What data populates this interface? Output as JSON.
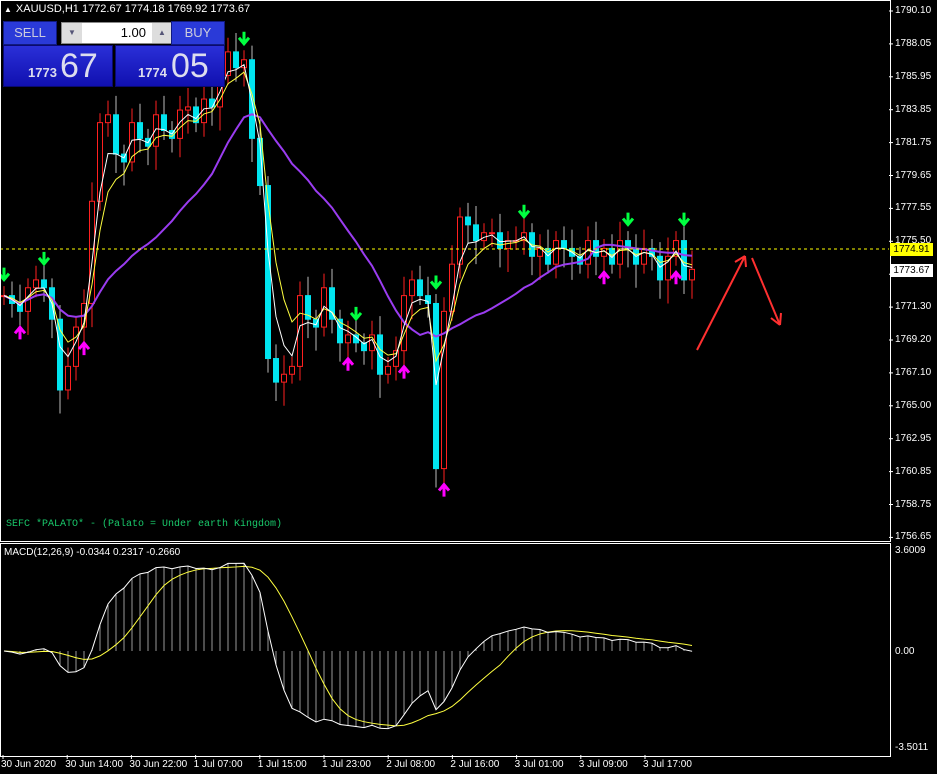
{
  "header": {
    "symbol": "XAUUSD,H1",
    "ohlc": "1772.67 1774.18 1769.92 1773.67"
  },
  "trade_panel": {
    "sell_label": "SELL",
    "buy_label": "BUY",
    "lot": "1.00",
    "sell_price_prefix": "1773",
    "sell_price_big": "67",
    "buy_price_prefix": "1774",
    "buy_price_big": "05"
  },
  "price_axis": [
    "1790.10",
    "1788.05",
    "1785.95",
    "1783.85",
    "1781.75",
    "1779.65",
    "1777.55",
    "1775.50",
    "1773.40",
    "1771.30",
    "1769.20",
    "1767.10",
    "1765.00",
    "1762.95",
    "1760.85",
    "1758.75",
    "1756.65"
  ],
  "price_tags": {
    "ask_line": "1774.91",
    "bid": "1773.67"
  },
  "note": "SEFC *PALATO* - (Palato = Under earth Kingdom)",
  "macd": {
    "label": "MACD(12,26,9) -0.0344 0.2317 -0.2660",
    "axis": [
      "3.6009",
      "0.00",
      "-3.5011"
    ]
  },
  "time_axis": [
    "30 Jun 2020",
    "30 Jun 14:00",
    "30 Jun 22:00",
    "1 Jul 07:00",
    "1 Jul 15:00",
    "1 Jul 23:00",
    "2 Jul 08:00",
    "2 Jul 16:00",
    "3 Jul 01:00",
    "3 Jul 09:00",
    "3 Jul 17:00"
  ],
  "colors": {
    "bull": "#ff2020",
    "bear": "#00e5f0",
    "fast_ma": "#ffffff",
    "mid_ma": "#ffff40",
    "slow_ma": "#9a3cf0",
    "sell_arrow": "#00ff40",
    "buy_arrow": "#ff00ff",
    "ask_line": "#ffff00",
    "annotation": "#ff3030"
  },
  "chart_data": {
    "type": "candlestick",
    "symbol": "XAUUSD",
    "timeframe": "H1",
    "ylim": [
      1756.65,
      1790.1
    ],
    "close": [
      1772.0,
      1771.5,
      1771.0,
      1772.5,
      1773.0,
      1772.5,
      1770.5,
      1766.0,
      1767.5,
      1770.0,
      1771.5,
      1778.0,
      1783.0,
      1783.5,
      1781.0,
      1780.5,
      1783.0,
      1782.0,
      1781.5,
      1783.5,
      1782.5,
      1782.0,
      1783.8,
      1784.0,
      1783.0,
      1784.5,
      1784.0,
      1786.0,
      1787.5,
      1786.5,
      1787.0,
      1782.0,
      1779.0,
      1768.0,
      1766.5,
      1767.0,
      1767.5,
      1772.0,
      1770.5,
      1770.0,
      1772.5,
      1770.5,
      1769.0,
      1769.5,
      1769.0,
      1768.5,
      1769.5,
      1767.0,
      1767.5,
      1768.5,
      1772.0,
      1773.0,
      1772.0,
      1771.5,
      1761.0,
      1771.0,
      1774.0,
      1777.0,
      1776.5,
      1775.5,
      1776.0,
      1776.0,
      1775.0,
      1775.5,
      1775.5,
      1776.0,
      1774.5,
      1775.0,
      1774.0,
      1775.5,
      1775.0,
      1774.5,
      1774.0,
      1775.5,
      1774.5,
      1775.0,
      1774.0,
      1775.5,
      1775.0,
      1774.0,
      1775.0,
      1774.5,
      1773.0,
      1774.5,
      1775.5,
      1773.0,
      1773.67
    ],
    "sell_signals": [
      0,
      5,
      30,
      44,
      54,
      65,
      78,
      85
    ],
    "buy_signals": [
      2,
      10,
      43,
      50,
      55,
      75,
      84
    ],
    "macd_ylim": [
      -3.5011,
      3.6009
    ]
  }
}
